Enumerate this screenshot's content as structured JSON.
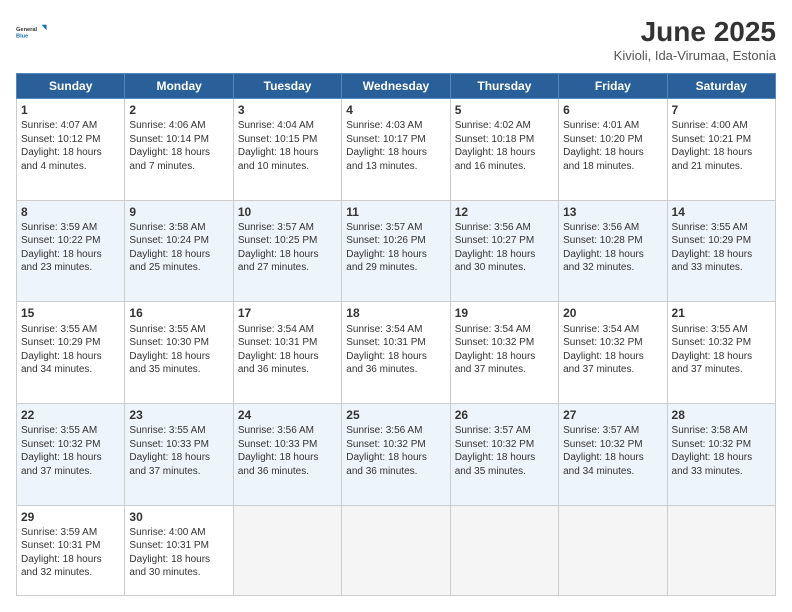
{
  "logo": {
    "line1": "General",
    "line2": "Blue"
  },
  "title": "June 2025",
  "location": "Kivioli, Ida-Virumaa, Estonia",
  "weekdays": [
    "Sunday",
    "Monday",
    "Tuesday",
    "Wednesday",
    "Thursday",
    "Friday",
    "Saturday"
  ],
  "days": [
    {
      "num": "1",
      "rise": "4:07 AM",
      "set": "10:12 PM",
      "daylight": "18 hours and 4 minutes."
    },
    {
      "num": "2",
      "rise": "4:06 AM",
      "set": "10:14 PM",
      "daylight": "18 hours and 7 minutes."
    },
    {
      "num": "3",
      "rise": "4:04 AM",
      "set": "10:15 PM",
      "daylight": "18 hours and 10 minutes."
    },
    {
      "num": "4",
      "rise": "4:03 AM",
      "set": "10:17 PM",
      "daylight": "18 hours and 13 minutes."
    },
    {
      "num": "5",
      "rise": "4:02 AM",
      "set": "10:18 PM",
      "daylight": "18 hours and 16 minutes."
    },
    {
      "num": "6",
      "rise": "4:01 AM",
      "set": "10:20 PM",
      "daylight": "18 hours and 18 minutes."
    },
    {
      "num": "7",
      "rise": "4:00 AM",
      "set": "10:21 PM",
      "daylight": "18 hours and 21 minutes."
    },
    {
      "num": "8",
      "rise": "3:59 AM",
      "set": "10:22 PM",
      "daylight": "18 hours and 23 minutes."
    },
    {
      "num": "9",
      "rise": "3:58 AM",
      "set": "10:24 PM",
      "daylight": "18 hours and 25 minutes."
    },
    {
      "num": "10",
      "rise": "3:57 AM",
      "set": "10:25 PM",
      "daylight": "18 hours and 27 minutes."
    },
    {
      "num": "11",
      "rise": "3:57 AM",
      "set": "10:26 PM",
      "daylight": "18 hours and 29 minutes."
    },
    {
      "num": "12",
      "rise": "3:56 AM",
      "set": "10:27 PM",
      "daylight": "18 hours and 30 minutes."
    },
    {
      "num": "13",
      "rise": "3:56 AM",
      "set": "10:28 PM",
      "daylight": "18 hours and 32 minutes."
    },
    {
      "num": "14",
      "rise": "3:55 AM",
      "set": "10:29 PM",
      "daylight": "18 hours and 33 minutes."
    },
    {
      "num": "15",
      "rise": "3:55 AM",
      "set": "10:29 PM",
      "daylight": "18 hours and 34 minutes."
    },
    {
      "num": "16",
      "rise": "3:55 AM",
      "set": "10:30 PM",
      "daylight": "18 hours and 35 minutes."
    },
    {
      "num": "17",
      "rise": "3:54 AM",
      "set": "10:31 PM",
      "daylight": "18 hours and 36 minutes."
    },
    {
      "num": "18",
      "rise": "3:54 AM",
      "set": "10:31 PM",
      "daylight": "18 hours and 36 minutes."
    },
    {
      "num": "19",
      "rise": "3:54 AM",
      "set": "10:32 PM",
      "daylight": "18 hours and 37 minutes."
    },
    {
      "num": "20",
      "rise": "3:54 AM",
      "set": "10:32 PM",
      "daylight": "18 hours and 37 minutes."
    },
    {
      "num": "21",
      "rise": "3:55 AM",
      "set": "10:32 PM",
      "daylight": "18 hours and 37 minutes."
    },
    {
      "num": "22",
      "rise": "3:55 AM",
      "set": "10:32 PM",
      "daylight": "18 hours and 37 minutes."
    },
    {
      "num": "23",
      "rise": "3:55 AM",
      "set": "10:33 PM",
      "daylight": "18 hours and 37 minutes."
    },
    {
      "num": "24",
      "rise": "3:56 AM",
      "set": "10:33 PM",
      "daylight": "18 hours and 36 minutes."
    },
    {
      "num": "25",
      "rise": "3:56 AM",
      "set": "10:32 PM",
      "daylight": "18 hours and 36 minutes."
    },
    {
      "num": "26",
      "rise": "3:57 AM",
      "set": "10:32 PM",
      "daylight": "18 hours and 35 minutes."
    },
    {
      "num": "27",
      "rise": "3:57 AM",
      "set": "10:32 PM",
      "daylight": "18 hours and 34 minutes."
    },
    {
      "num": "28",
      "rise": "3:58 AM",
      "set": "10:32 PM",
      "daylight": "18 hours and 33 minutes."
    },
    {
      "num": "29",
      "rise": "3:59 AM",
      "set": "10:31 PM",
      "daylight": "18 hours and 32 minutes."
    },
    {
      "num": "30",
      "rise": "4:00 AM",
      "set": "10:31 PM",
      "daylight": "18 hours and 30 minutes."
    }
  ],
  "labels": {
    "sunrise": "Sunrise:",
    "sunset": "Sunset:",
    "daylight": "Daylight:"
  }
}
